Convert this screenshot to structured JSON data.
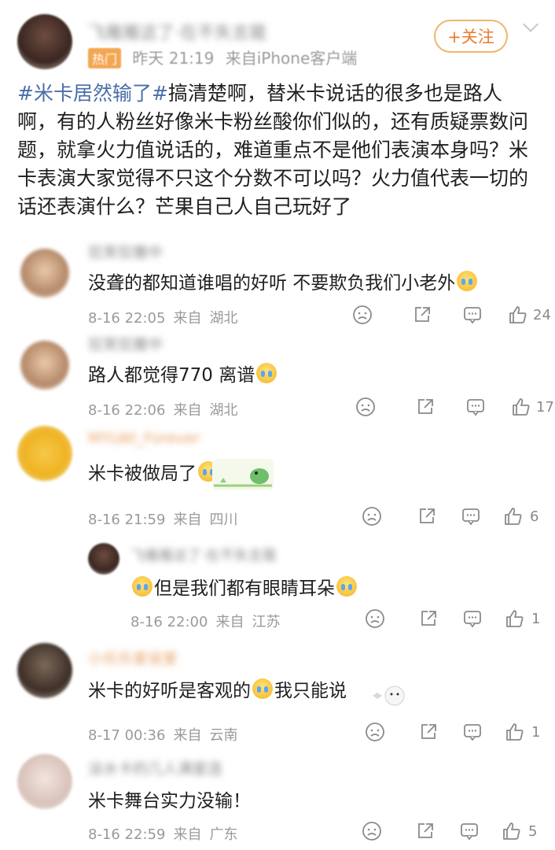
{
  "post": {
    "author_name": "飞雁雁这了·在不失言箴",
    "badge": "热门",
    "time": "昨天 21:19",
    "source": "来自iPhone客户端",
    "follow_label": "+关注",
    "hashtag": "#米卡居然输了#",
    "text": "搞清楚啊，替米卡说话的很多也是路人啊，有的人粉丝好像米卡粉丝酸你们似的，还有质疑票数问题，就拿火力值说话的，难道重点不是他们表演本身吗？米卡表演大家觉得不只这个分数不可以吗？火力值代表一切的话还表演什么？芒果自己人自己玩好了"
  },
  "comments": [
    {
      "name": "狂笑狂撒中",
      "text": "没聋的都知道谁唱的好听 不要欺负我们小老外",
      "date": "8-16 22:05",
      "from": "来自",
      "location": "湖北",
      "likes": "24"
    },
    {
      "name": "狂笑狂撒中",
      "text": "路人都觉得770 离谱",
      "date": "8-16 22:06",
      "from": "来自",
      "location": "湖北",
      "likes": "17"
    },
    {
      "name": "MYLWI_Forever",
      "text": "米卡被做局了",
      "date": "8-16 21:59",
      "from": "来自",
      "location": "四川",
      "likes": "6"
    },
    {
      "name": "飞雁雁这了·在不失言箴",
      "text": "但是我们都有眼睛耳朵",
      "date": "8-16 22:00",
      "from": "来自",
      "location": "江苏",
      "likes": "1"
    },
    {
      "name": "小乐乐爱说爱",
      "text": "米卡的好听是客观的",
      "text2": "我只能说",
      "date": "8-17 00:36",
      "from": "来自",
      "location": "云南",
      "likes": "1"
    },
    {
      "name": "淡水卡的几人满星连",
      "text": "米卡舞台实力没输！",
      "date": "8-16 22:59",
      "from": "来自",
      "location": "广东",
      "likes": "5"
    }
  ],
  "icons": [
    "dislike-icon",
    "share-icon",
    "comment-icon",
    "like-icon",
    "chevron-down-icon",
    "crying-emoji-icon"
  ],
  "colors": {
    "hashtag": "#4a6ea8",
    "follow": "#eb7a2d",
    "badge": "#f3a653"
  }
}
